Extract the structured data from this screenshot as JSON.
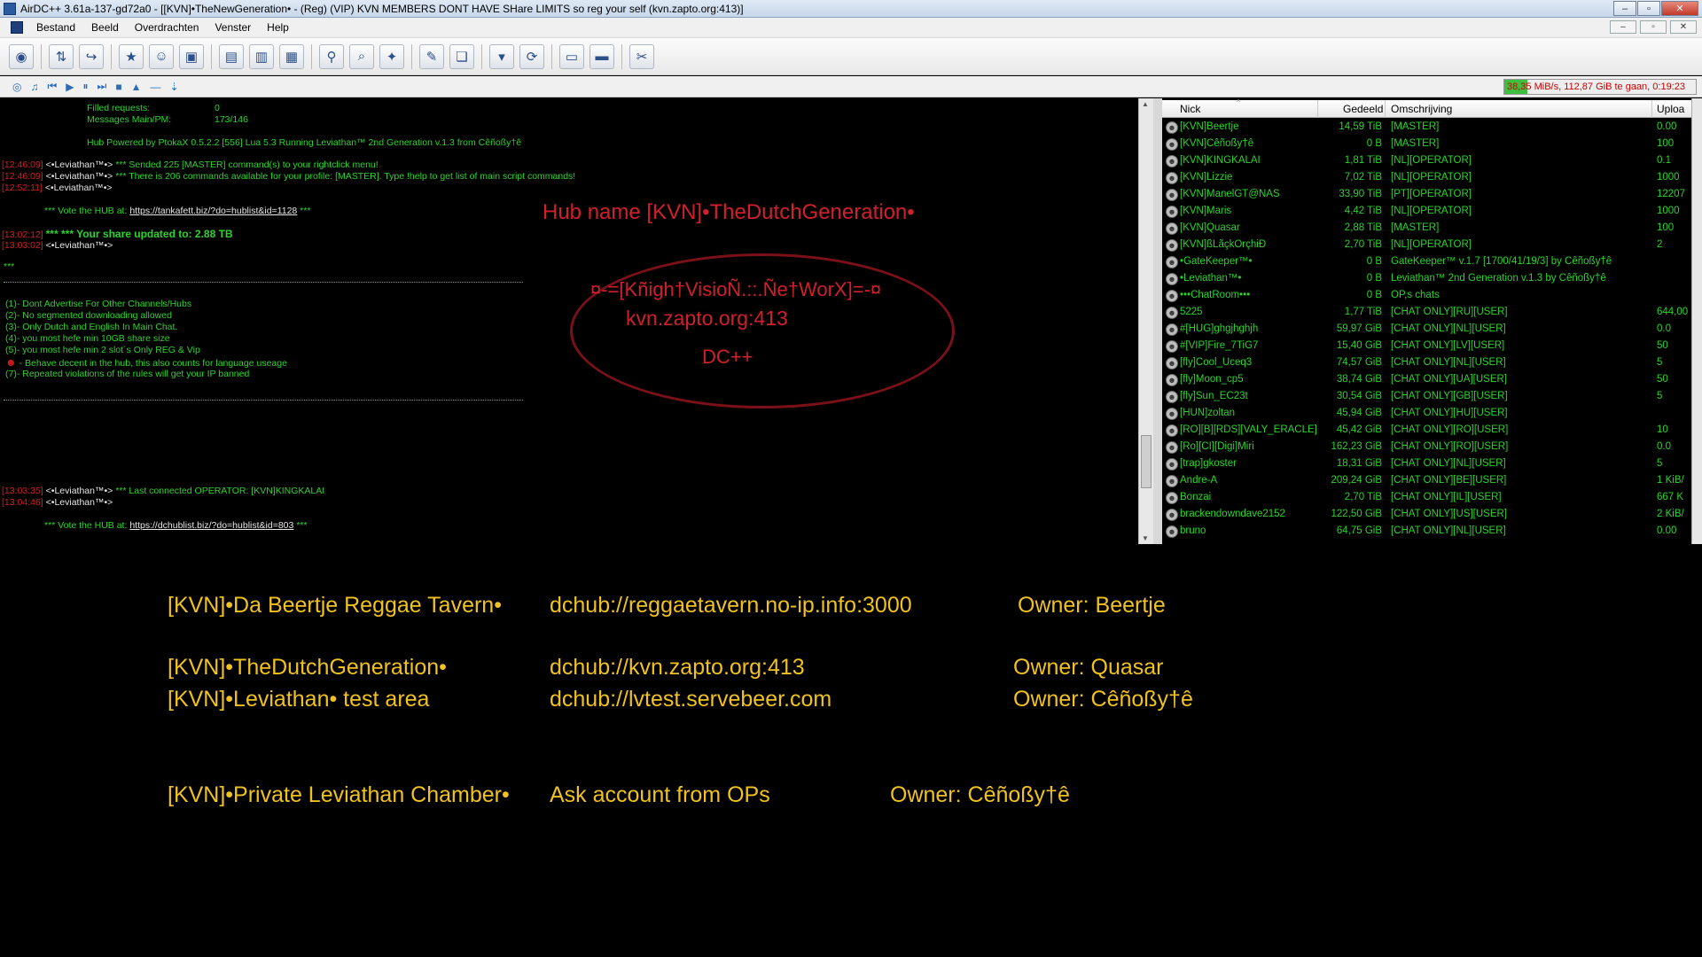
{
  "window": {
    "title": "AirDC++ 3.61a-137-gd72a0 - [[KVN]•TheNewGeneration• - (Reg) (VIP) KVN MEMBERS DONT HAVE SHare LIMITS   so reg your self   (kvn.zapto.org:413)]",
    "minimize": "–",
    "maximize": "▫",
    "close": "✕"
  },
  "menu": {
    "items": [
      "Bestand",
      "Beeld",
      "Overdrachten",
      "Venster",
      "Help"
    ],
    "mdi_minimize": "–",
    "mdi_restore": "▫",
    "mdi_close": "✕"
  },
  "toolbar": {
    "icons": [
      "public-hubs-icon",
      "reconnect-icon",
      "follow-redirect-icon",
      "favorite-hubs-icon",
      "favorite-users-icon",
      "recent-hubs-icon",
      "download-queue-icon",
      "upload-queue-icon",
      "finished-downloads-icon",
      "search-icon",
      "adl-search-icon",
      "search-spy-icon",
      "notepad-icon",
      "system-log-icon",
      "open-filelist-icon",
      "refresh-share-icon",
      "open-downloads-icon",
      "open-own-list-icon",
      "settings-icon"
    ]
  },
  "toolbar2": {
    "icons": [
      "connect-icon",
      "music-icon",
      "skip-back-icon",
      "play-icon",
      "pause-icon",
      "next-icon",
      "stop-icon",
      "volume-up-icon",
      "volume-mute-icon",
      "volume-down-icon"
    ]
  },
  "transfer_status": {
    "text": "38,35 MiB/s, 112,87 GiB te gaan, 0:19:23",
    "progress": 0.12
  },
  "chat": {
    "lines": [
      {
        "label": "Filled requests:",
        "value": "0"
      },
      {
        "label": "Messages Main/PM:",
        "value": "173/146"
      },
      {
        "text": "Hub Powered by PtokaX 0.5.2.2 [556] Lua 5.3 Running Leviathan™ 2nd Generation v.1.3 from Cêñoßy†ê"
      },
      {
        "ts": "[12:46:09]",
        "nick": "<•Leviathan™•>",
        "msg": "*** Sended 225 [MASTER] command(s) to your rightclick menu!"
      },
      {
        "ts": "[12:46:09]",
        "nick": "<•Leviathan™•>",
        "msg": "*** There is 206 commands available for your profile: [MASTER]. Type !help to get list of main script commands!"
      },
      {
        "ts": "[12:52:11]",
        "nick": "<•Leviathan™•>",
        "msg": ""
      },
      {
        "pre": "*** Vote the HUB at: ",
        "link": "https://tankafett.biz/?do=hublist&id=1128",
        "post": " ***"
      },
      {
        "ts": "[13:02:12]",
        "msg": "*** *** Your share updated to: 2.88 TB"
      },
      {
        "ts": "[13:03:02]",
        "nick": "<•Leviathan™•>",
        "msg": ""
      },
      {
        "text": "***"
      },
      {
        "text": "(1)- Dont Advertise For Other Channels/Hubs"
      },
      {
        "text": "(2)- No segmented downloading allowed"
      },
      {
        "text": "(3)- Only Dutch and English In Main Chat."
      },
      {
        "text": "(4)- you most hefe min 10GB share size"
      },
      {
        "text": "(5)- you most hefe min 2 slot´s Only REG & Vip"
      },
      {
        "text": "- Behave decent in the hub, this also counts for language useage"
      },
      {
        "text": "(7)- Repeated violations of the rules will get your IP banned"
      },
      {
        "ts": "[13:03:35]",
        "nick": "<•Leviathan™•>",
        "msg": "*** Last connected OPERATOR: [KVN]KINGKALAI"
      },
      {
        "ts": "[13:04:46]",
        "nick": "<•Leviathan™•>",
        "msg": ""
      },
      {
        "pre": "*** Vote the HUB at: ",
        "link": "https://dchublist.biz/?do=hublist&id=803",
        "post": " ***"
      }
    ]
  },
  "overlay": {
    "hub_name": "Hub name [KVN]•TheDutchGeneration•",
    "network": "¤-=[Kñigh†VisioÑ.::.Ñe†WorX]=-¤",
    "address": "kvn.zapto.org:413",
    "client": "DC++"
  },
  "userlist": {
    "columns": [
      "Nick",
      "Gedeeld",
      "Omschrijving",
      "Uploa"
    ],
    "users": [
      {
        "nick": "[KVN]Beertje",
        "shared": "14,59 TiB",
        "desc": "[MASTER]",
        "upload": "0.00"
      },
      {
        "nick": "[KVN]Cêñoßy†ê",
        "shared": "0 B",
        "desc": "[MASTER]",
        "upload": "100"
      },
      {
        "nick": "[KVN]KINGKALAI",
        "shared": "1,81 TiB",
        "desc": "[NL][OPERATOR]",
        "upload": "0.1"
      },
      {
        "nick": "[KVN]Lizzie",
        "shared": "7,02 TiB",
        "desc": "[NL][OPERATOR]",
        "upload": "1000"
      },
      {
        "nick": "[KVN]ManelGT@NAS",
        "shared": "33,90 TiB",
        "desc": "[PT][OPERATOR]",
        "upload": "12207"
      },
      {
        "nick": "[KVN]Maris",
        "shared": "4,42 TiB",
        "desc": "[NL][OPERATOR]",
        "upload": "1000"
      },
      {
        "nick": "[KVN]Quasar",
        "shared": "2,88 TiB",
        "desc": "[MASTER]",
        "upload": "100"
      },
      {
        "nick": "[KVN]ßĹãçkÕrçhiÐ",
        "shared": "2,70 TiB",
        "desc": "[NL][OPERATOR]",
        "upload": "2"
      },
      {
        "nick": "•GateKeeper™•",
        "shared": "0 B",
        "desc": "GateKeeper™ v.1.7 [1700/41/19/3] by Cêñoßy†ê",
        "upload": ""
      },
      {
        "nick": "•Leviathan™•",
        "shared": "0 B",
        "desc": "Leviathan™ 2nd Generation v.1.3 by Cêñoßy†ê",
        "upload": ""
      },
      {
        "nick": "•••ChatRoom•••",
        "shared": "0 B",
        "desc": "OP,s chats",
        "upload": ""
      },
      {
        "nick": "5225",
        "shared": "1,77 TiB",
        "desc": "[CHAT ONLY][RU][USER]",
        "upload": "644,00"
      },
      {
        "nick": "#[HUG]ghgjhghjh",
        "shared": "59,97 GiB",
        "desc": "[CHAT ONLY][NL][USER]",
        "upload": "0.0"
      },
      {
        "nick": "#[VIP]Fire_7TiG7",
        "shared": "15,40 GiB",
        "desc": "[CHAT ONLY][LV][USER]",
        "upload": "50"
      },
      {
        "nick": "[fly]Cool_Uceq3",
        "shared": "74,57 GiB",
        "desc": "[CHAT ONLY][NL][USER]",
        "upload": "5"
      },
      {
        "nick": "[fly]Moon_cp5",
        "shared": "38,74 GiB",
        "desc": "[CHAT ONLY][UA][USER]",
        "upload": "50"
      },
      {
        "nick": "[fly]Sun_EC23t",
        "shared": "30,54 GiB",
        "desc": "[CHAT ONLY][GB][USER]",
        "upload": "5"
      },
      {
        "nick": "[HUN]zoltan",
        "shared": "45,94 GiB",
        "desc": "[CHAT ONLY][HU][USER]",
        "upload": ""
      },
      {
        "nick": "[RO][B][RDS][VALY_ERACLE]",
        "shared": "45,42 GiB",
        "desc": "[CHAT ONLY][RO][USER]",
        "upload": "10"
      },
      {
        "nick": "[Ro][CI][Digi]Miri",
        "shared": "162,23 GiB",
        "desc": "[CHAT ONLY][RO][USER]",
        "upload": "0.0"
      },
      {
        "nick": "[trap]gkoster",
        "shared": "18,31 GiB",
        "desc": "[CHAT ONLY][NL][USER]",
        "upload": "5"
      },
      {
        "nick": "Andre-A",
        "shared": "209,24 GiB",
        "desc": "[CHAT ONLY][BE][USER]",
        "upload": "1 KiB/"
      },
      {
        "nick": "Bonzai",
        "shared": "2,70 TiB",
        "desc": "[CHAT ONLY][IL][USER]",
        "upload": "667 K"
      },
      {
        "nick": "brackendowndave2152",
        "shared": "122,50 GiB",
        "desc": "[CHAT ONLY][US][USER]",
        "upload": "2 KiB/"
      },
      {
        "nick": "bruno",
        "shared": "64,75 GiB",
        "desc": "[CHAT ONLY][NL][USER]",
        "upload": "0.00"
      }
    ]
  },
  "hubs": [
    {
      "name": "[KVN]•Da Beertje Reggae Tavern•",
      "address": "dchub://reggaetavern.no-ip.info:3000",
      "owner": "Owner: Beertje"
    },
    {
      "name": "[KVN]•TheDutchGeneration•",
      "address": "dchub://kvn.zapto.org:413",
      "owner": "Owner: Quasar"
    },
    {
      "name": "[KVN]•Leviathan• test area",
      "address": "dchub://lvtest.servebeer.com",
      "owner": "Owner: Cêñoßy†ê"
    },
    {
      "name": "[KVN]•Private Leviathan Chamber•",
      "address": "Ask account from OPs",
      "owner": "Owner: Cêñoßy†ê"
    }
  ]
}
